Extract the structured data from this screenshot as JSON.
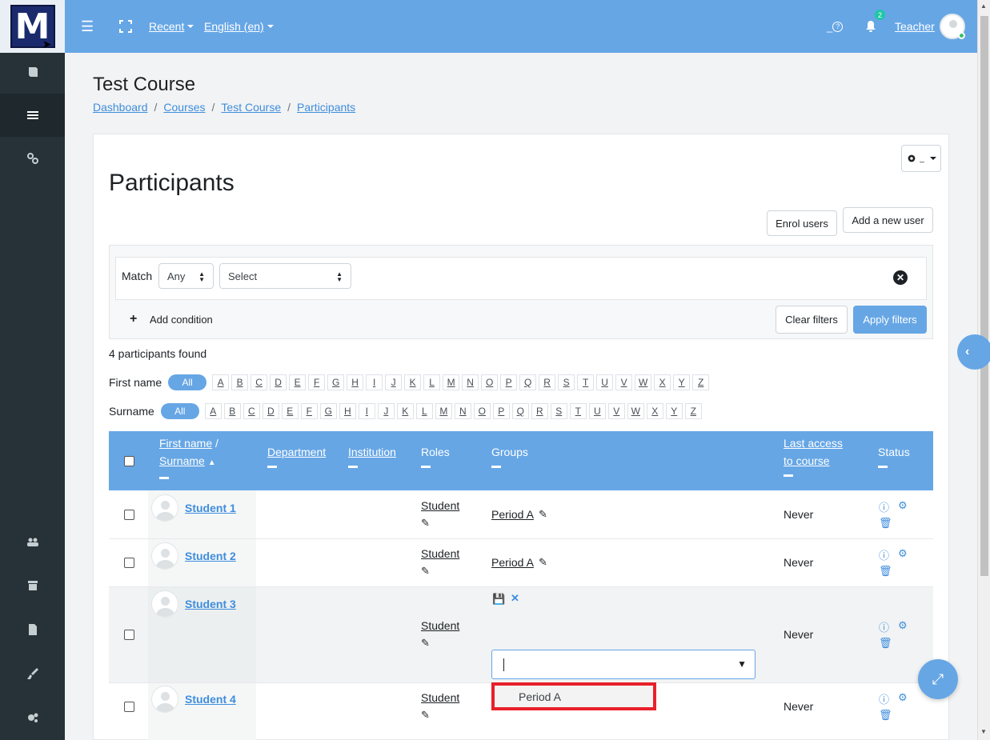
{
  "nav": {
    "recent": "Recent",
    "language": "English (en)",
    "notifications_count": "2",
    "user_name": "Teacher"
  },
  "sidebar": {
    "logo_letter": "M",
    "icons": [
      "book-icon",
      "list-icon",
      "link-icon",
      "users-icon",
      "archive-icon",
      "file-icon",
      "brush-icon",
      "settings-icon"
    ]
  },
  "course": {
    "title": "Test Course",
    "breadcrumb": [
      "Dashboard",
      "Courses",
      "Test Course",
      "Participants"
    ]
  },
  "page": {
    "heading": "Participants",
    "enrol_label": "Enrol users",
    "add_user_label": "Add a new user"
  },
  "filter": {
    "match_label": "Match",
    "match_value": "Any",
    "select_value": "Select",
    "add_condition": "Add condition",
    "clear_filters": "Clear filters",
    "apply_filters": "Apply filters"
  },
  "found_text": "4 participants found",
  "initials": {
    "first_label": "First name",
    "surname_label": "Surname",
    "all": "All",
    "letters": [
      "A",
      "B",
      "C",
      "D",
      "E",
      "F",
      "G",
      "H",
      "I",
      "J",
      "K",
      "L",
      "M",
      "N",
      "O",
      "P",
      "Q",
      "R",
      "S",
      "T",
      "U",
      "V",
      "W",
      "X",
      "Y",
      "Z"
    ]
  },
  "table": {
    "headers": {
      "first_name": "First name",
      "slash": " /",
      "surname": "Surname",
      "department": "Department",
      "institution": "Institution",
      "roles": "Roles",
      "groups": "Groups",
      "last_access_1": "Last access",
      "last_access_2": "to course",
      "status": "Status"
    },
    "rows": [
      {
        "name": "Student 1",
        "role": "Student",
        "group": "Period A",
        "last_access": "Never"
      },
      {
        "name": "Student 2",
        "role": "Student",
        "group": "Period A",
        "last_access": "Never"
      },
      {
        "name": "Student 3",
        "role": "Student",
        "group": "",
        "last_access": "Never"
      },
      {
        "name": "Student 4",
        "role": "Student",
        "group": "",
        "last_access": "Never"
      }
    ]
  },
  "group_dropdown": {
    "option": "Period A"
  },
  "colors": {
    "primary": "#66a6e5",
    "sidebar": "#263238",
    "highlight_border": "#e8202a"
  }
}
